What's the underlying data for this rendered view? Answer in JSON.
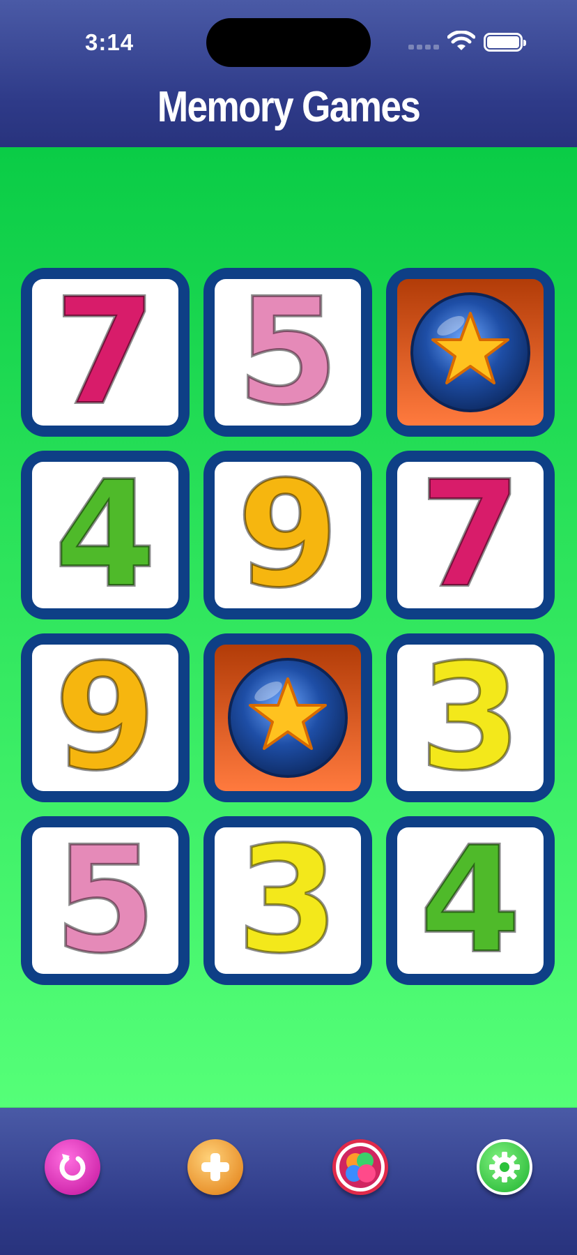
{
  "status_bar": {
    "time": "3:14"
  },
  "header": {
    "title": "Memory Games"
  },
  "cards": [
    {
      "row": 0,
      "col": 0,
      "state": "face-up",
      "label": "7",
      "color": "#d81c6a"
    },
    {
      "row": 0,
      "col": 1,
      "state": "face-up",
      "label": "5",
      "color": "#e58ab8"
    },
    {
      "row": 0,
      "col": 2,
      "state": "face-down",
      "icon": "star-icon"
    },
    {
      "row": 1,
      "col": 0,
      "state": "face-up",
      "label": "4",
      "color": "#4fba2a"
    },
    {
      "row": 1,
      "col": 1,
      "state": "face-up",
      "label": "9",
      "color": "#f6b60f"
    },
    {
      "row": 1,
      "col": 2,
      "state": "face-up",
      "label": "7",
      "color": "#d81c6a"
    },
    {
      "row": 2,
      "col": 0,
      "state": "face-up",
      "label": "9",
      "color": "#f6b60f"
    },
    {
      "row": 2,
      "col": 1,
      "state": "face-down",
      "icon": "star-icon"
    },
    {
      "row": 2,
      "col": 2,
      "state": "face-up",
      "label": "3",
      "color": "#f3e81b"
    },
    {
      "row": 3,
      "col": 0,
      "state": "face-up",
      "label": "5",
      "color": "#e58ab8"
    },
    {
      "row": 3,
      "col": 1,
      "state": "face-up",
      "label": "3",
      "color": "#f3e81b"
    },
    {
      "row": 3,
      "col": 2,
      "state": "face-up",
      "label": "4",
      "color": "#4fba2a"
    }
  ],
  "toolbar": {
    "buttons": [
      {
        "name": "restart-button",
        "icon": "restart-icon",
        "color": "#e020b8"
      },
      {
        "name": "new-game-button",
        "icon": "plus-icon",
        "color": "#f59a1e"
      },
      {
        "name": "more-games-button",
        "icon": "colorful-balls-icon",
        "color": "#e8324a"
      },
      {
        "name": "settings-button",
        "icon": "gear-icon",
        "color": "#3ccf3c"
      }
    ]
  }
}
